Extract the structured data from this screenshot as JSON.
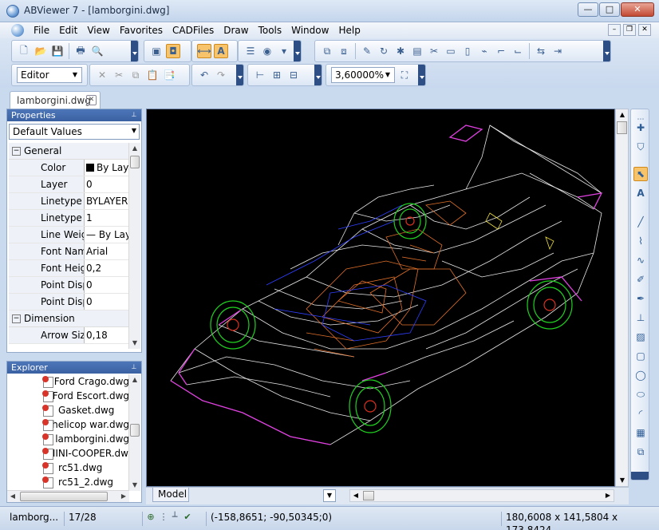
{
  "window": {
    "title": "ABViewer 7 - [lamborgini.dwg]",
    "minimize": "—",
    "maximize": "□",
    "close": "✕"
  },
  "menu": {
    "items": [
      "File",
      "Edit",
      "View",
      "Favorites",
      "CADFiles",
      "Draw",
      "Tools",
      "Window",
      "Help"
    ],
    "mdi": {
      "minimize": "–",
      "restore": "❐",
      "close": "✕"
    }
  },
  "toolbar": {
    "mode_value": "Editor",
    "zoom_value": "3,60000%"
  },
  "doc_tab": {
    "label": "lamborgini.dwg",
    "close": "✕"
  },
  "properties": {
    "header": "Properties",
    "dropdown_value": "Default Values",
    "sections": [
      {
        "label": "General",
        "rows": [
          {
            "name": "Color",
            "value": "By Layer"
          },
          {
            "name": "Layer",
            "value": "0"
          },
          {
            "name": "Linetype",
            "value": "BYLAYER"
          },
          {
            "name": "Linetype scale",
            "value": "1"
          },
          {
            "name": "Line Weight",
            "value": "— By Layer"
          },
          {
            "name": "Font Name",
            "value": "Arial"
          },
          {
            "name": "Font Height",
            "value": "0,2"
          },
          {
            "name": "Point Display",
            "value": "0"
          },
          {
            "name": "Point Display",
            "value": "0"
          }
        ]
      },
      {
        "label": "Dimension",
        "rows": [
          {
            "name": "Arrow Size",
            "value": "0,18"
          }
        ]
      }
    ]
  },
  "explorer": {
    "header": "Explorer",
    "files": [
      "Ford Crago.dwg",
      "Ford Escort.dwg",
      "Gasket.dwg",
      "helicop war.dwg",
      "lamborgini.dwg",
      "MINI-COOPER.dwg",
      "rc51.dwg",
      "rc51_2.dwg"
    ]
  },
  "canvas": {
    "model_tab": "Model"
  },
  "status": {
    "file": "lamborg...",
    "page": "17/28",
    "coords": "(-158,8651; -90,50345;0)",
    "dimensions": "180,6008 x 141,5804 x 173,8424"
  },
  "colors": {
    "accent": "#3a62a3",
    "canvas_bg": "#000000",
    "active_tool": "#f7c46b"
  }
}
